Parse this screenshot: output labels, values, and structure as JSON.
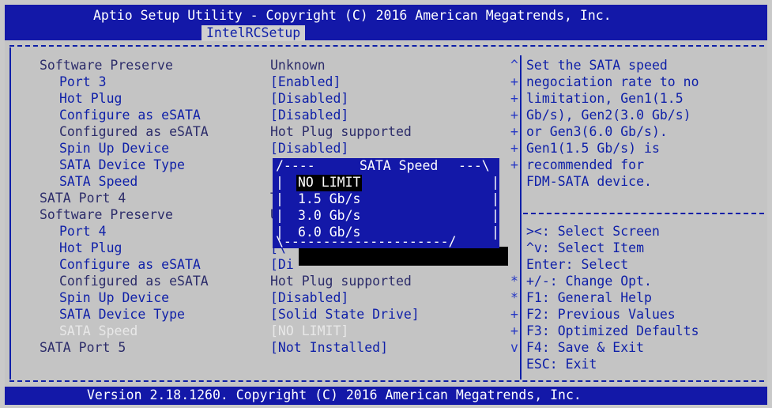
{
  "header": {
    "title": "Aptio Setup Utility - Copyright (C) 2016 American Megatrends, Inc.",
    "tab": "IntelRCSetup"
  },
  "footer": {
    "version": "Version 2.18.1260. Copyright (C) 2016 American Megatrends, Inc."
  },
  "settings": [
    {
      "label": "Software Preserve",
      "value": "Unknown"
    },
    {
      "label": "Port 3",
      "value": "[Enabled]"
    },
    {
      "label": "Hot Plug",
      "value": "[Disabled]"
    },
    {
      "label": "Configure as eSATA",
      "value": "[Disabled]"
    },
    {
      "label": "Configured as eSATA",
      "value": "Hot Plug supported"
    },
    {
      "label": "Spin Up Device",
      "value": "[Disabled]"
    },
    {
      "label": "SATA Device Type",
      "value": "[/"
    },
    {
      "label": "SATA Speed",
      "value": "[|"
    },
    {
      "label": "SATA Port 4",
      "value": "T|"
    },
    {
      "label": "Software Preserve",
      "value": "U|"
    },
    {
      "label": "Port 4",
      "value": "[|"
    },
    {
      "label": "Hot Plug",
      "value": "[\\"
    },
    {
      "label": "Configure as eSATA",
      "value": "[Di"
    },
    {
      "label": "Configured as eSATA",
      "value": "Hot Plug supported"
    },
    {
      "label": "Spin Up Device",
      "value": "[Disabled]"
    },
    {
      "label": "SATA Device Type",
      "value": "[Solid State Drive]"
    },
    {
      "label": "SATA Speed",
      "value": "[NO LIMIT]"
    },
    {
      "label": "SATA Port 5",
      "value": "[Not Installed]"
    }
  ],
  "scroll_marks": [
    "^",
    "+",
    "+",
    "+",
    "+",
    "+",
    "+",
    "",
    "",
    "",
    "",
    "",
    "*",
    "*",
    "+",
    "+",
    "v"
  ],
  "help": {
    "lines": [
      "Set the SATA speed",
      "negociation rate to no",
      "limitation, Gen1(1.5",
      "Gb/s), Gen2(3.0 Gb/s)",
      "or Gen3(6.0 Gb/s).",
      "Gen1(1.5 Gb/s) is",
      "recommended for",
      "FDM-SATA device."
    ],
    "keys": [
      "><: Select Screen",
      "^v: Select Item",
      "Enter: Select",
      "+/-: Change Opt.",
      "F1: General Help",
      "F2: Previous Values",
      "F3: Optimized Defaults",
      "F4: Save & Exit",
      "ESC: Exit"
    ]
  },
  "popup": {
    "title": "SATA Speed",
    "options": [
      "NO LIMIT",
      "1.5 Gb/s",
      "3.0 Gb/s",
      "6.0 Gb/s"
    ],
    "selected": "NO LIMIT"
  },
  "colors": {
    "header_bg": "#1318a8",
    "body_bg": "#c4c4c4",
    "text": "#0e1fa8"
  }
}
